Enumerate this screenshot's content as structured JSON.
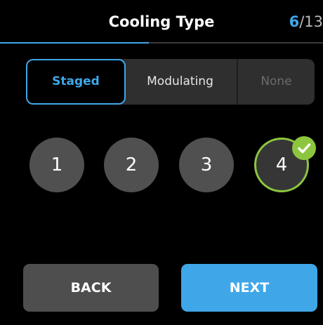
{
  "header": {
    "title": "Cooling Type",
    "step_current": "6",
    "step_total": "/13",
    "progress_fraction": 0.46
  },
  "cooling_type": {
    "options": [
      "Staged",
      "Modulating",
      "None"
    ],
    "selected": "Staged"
  },
  "stages": {
    "options": [
      "1",
      "2",
      "3",
      "4"
    ],
    "selected": "4"
  },
  "footer": {
    "back_label": "BACK",
    "next_label": "NEXT"
  },
  "colors": {
    "accent": "#3fa7e8",
    "selected_ring": "#8cc63f",
    "disabled_text": "#6b6b6b"
  },
  "icons": {
    "selected_badge": "checkmark-icon"
  }
}
